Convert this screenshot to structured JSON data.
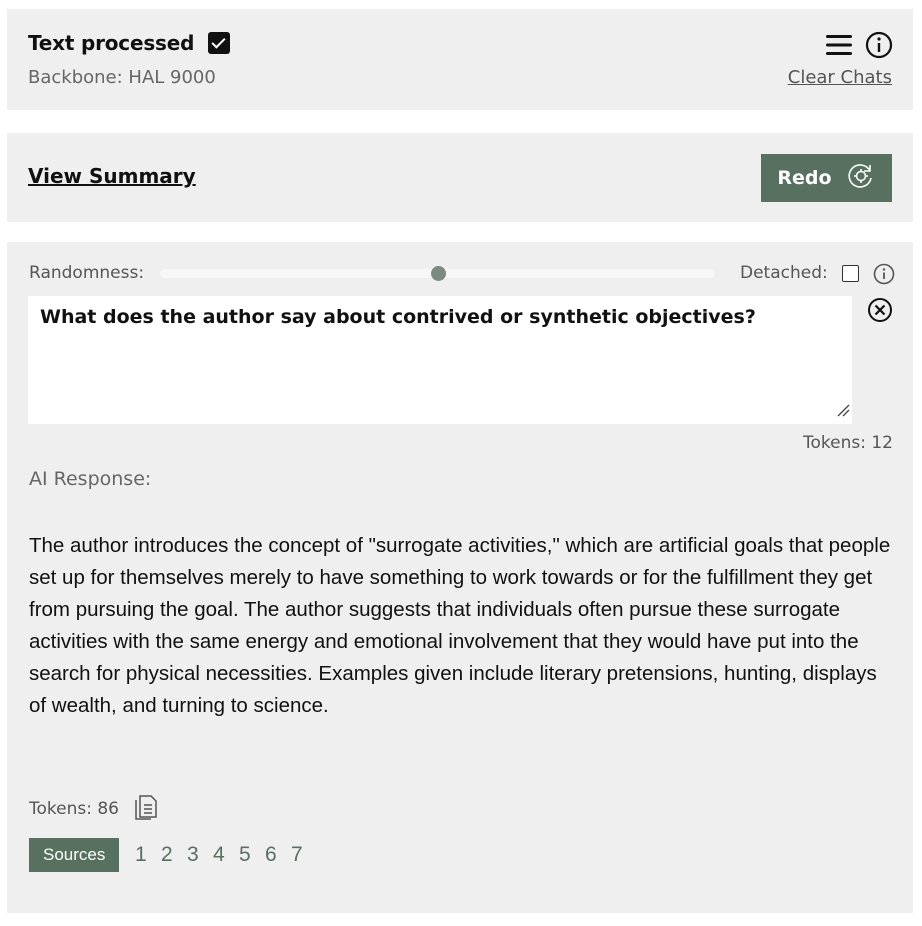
{
  "header": {
    "title": "Text processed",
    "backbone": "Backbone: HAL 9000",
    "clear_chats": "Clear Chats",
    "icons": [
      "menu-icon",
      "info-icon"
    ]
  },
  "summary_bar": {
    "view_summary": "View Summary",
    "redo_label": "Redo"
  },
  "query": {
    "randomness_label": "Randomness:",
    "randomness_value": 0.5,
    "detached_label": "Detached:",
    "detached_checked": false,
    "question": "What does the author say about contrived or synthetic objectives?",
    "tokens": "Tokens: 12"
  },
  "response": {
    "label": "AI Response:",
    "text": "The author introduces the concept of \"surrogate activities,\" which are artificial goals that people set up for themselves merely to have something to work towards or for the fulfillment they get from pursuing the goal. The author suggests that individuals often pursue these surrogate activities with the same energy and emotional involvement that they would have put into the search for physical necessities. Examples given include literary pretensions, hunting, displays of wealth, and turning to science.",
    "tokens": "Tokens: 86"
  },
  "sources": {
    "label": "Sources",
    "items": [
      "1",
      "2",
      "3",
      "4",
      "5",
      "6",
      "7"
    ]
  },
  "colors": {
    "accent": "#587060",
    "panel": "#efefef"
  }
}
